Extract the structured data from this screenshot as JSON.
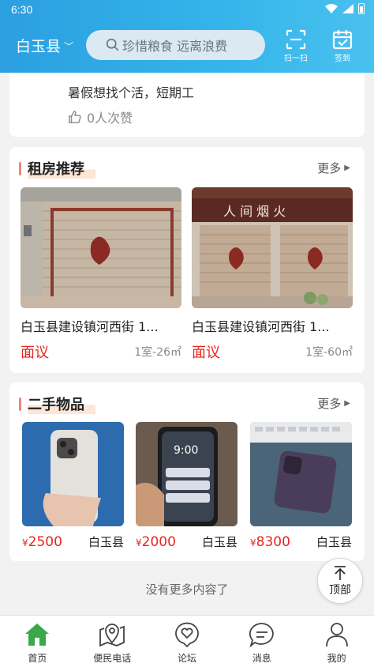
{
  "status_bar": {
    "time": "6:30"
  },
  "header": {
    "region": "白玉县",
    "search_placeholder": "珍惜粮食 远离浪费",
    "scan_label": "扫一扫",
    "signin_label": "签到",
    "accent_color": "#33b3ea"
  },
  "post": {
    "text": "暑假想找个活，短期工",
    "likes": "0人次赞"
  },
  "rent": {
    "title": "租房推荐",
    "more": "更多",
    "items": [
      {
        "title": "白玉县建设镇河西街 1...",
        "price": "面议",
        "meta": "1室-26㎡"
      },
      {
        "title": "白玉县建设镇河西街 1...",
        "price": "面议",
        "meta": "1室-60㎡"
      }
    ]
  },
  "used": {
    "title": "二手物品",
    "more": "更多",
    "items": [
      {
        "price": "2500",
        "currency": "¥",
        "location": "白玉县"
      },
      {
        "price": "2000",
        "currency": "¥",
        "location": "白玉县"
      },
      {
        "price": "8300",
        "currency": "¥",
        "location": "白玉县"
      }
    ]
  },
  "no_more": "没有更多内容了",
  "top_button": "顶部",
  "bottom_nav": [
    {
      "label": "首页",
      "icon": "home-icon",
      "active": true
    },
    {
      "label": "便民电话",
      "icon": "map-pin-icon"
    },
    {
      "label": "论坛",
      "icon": "heart-chat-icon"
    },
    {
      "label": "消息",
      "icon": "message-icon"
    },
    {
      "label": "我的",
      "icon": "user-icon"
    }
  ],
  "colors": {
    "price_red": "#e6261f",
    "nav_active": "#3aa84a",
    "title_accent": "#f0847c"
  }
}
